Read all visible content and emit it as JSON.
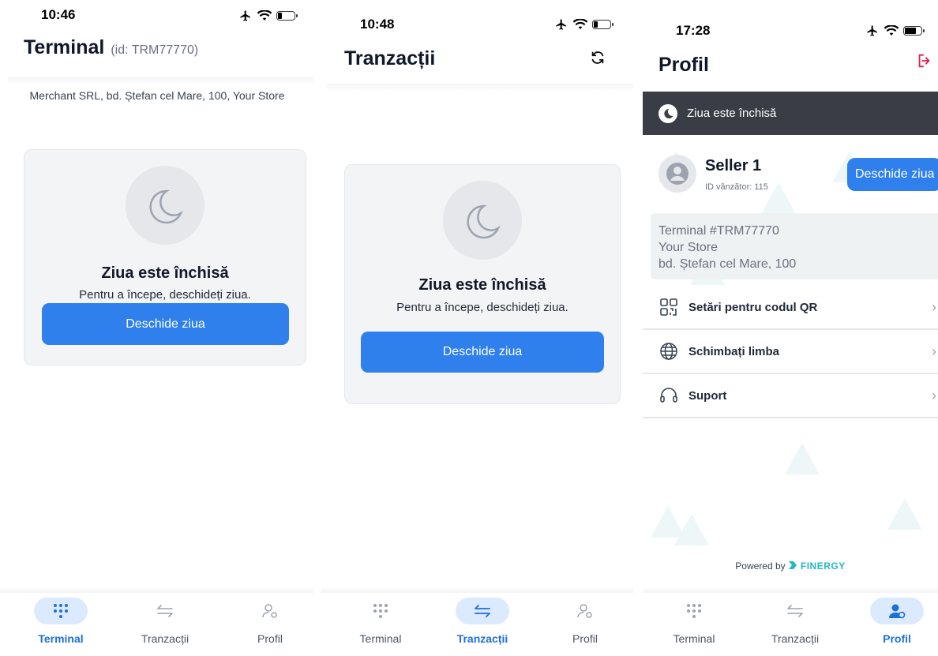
{
  "screens": {
    "terminal": {
      "status_time": "10:46",
      "title": "Terminal",
      "subtitle": "(id: TRM77770)",
      "merchant": "Merchant SRL, bd. Ștefan cel Mare, 100, Your Store",
      "card": {
        "icon": "moon-icon",
        "title": "Ziua este închisă",
        "subtitle": "Pentru a începe, deschideți ziua.",
        "button": "Deschide ziua"
      },
      "active_tab": "Terminal"
    },
    "transactions": {
      "status_time": "10:48",
      "title": "Tranzacții",
      "header_icon": "refresh-icon",
      "card": {
        "icon": "moon-icon",
        "title": "Ziua este închisă",
        "subtitle": "Pentru a începe, deschideți ziua.",
        "button": "Deschide ziua"
      },
      "active_tab": "Tranzacții"
    },
    "profile": {
      "status_time": "17:28",
      "title": "Profil",
      "header_icon": "logout-icon",
      "banner": "Ziua este închisă",
      "seller_name": "Seller 1",
      "seller_id": "ID vânzător: 115",
      "open_button": "Deschide ziua",
      "terminal_lines": [
        "Terminal #TRM77770",
        "Your Store",
        "bd. Ștefan cel Mare, 100"
      ],
      "menu": [
        {
          "label": "Setări pentru codul QR",
          "icon": "qr-code-icon"
        },
        {
          "label": "Schimbați limba",
          "icon": "globe-icon"
        },
        {
          "label": "Suport",
          "icon": "headset-icon"
        }
      ],
      "powered_by": "Powered by",
      "brand": "FINERGY",
      "active_tab": "Profil"
    }
  },
  "tabs": [
    {
      "label": "Terminal",
      "icon": "keypad-icon"
    },
    {
      "label": "Tranzacții",
      "icon": "transfer-arrows-icon"
    },
    {
      "label": "Profil",
      "icon": "user-settings-icon"
    }
  ],
  "colors": {
    "primary": "#2f80ed",
    "active_tab_text": "#1d6fd8",
    "active_tab_pill": "#dbeafe",
    "banner": "#3a3d45",
    "logout": "#e11d48",
    "brand": "#22b8c8"
  }
}
